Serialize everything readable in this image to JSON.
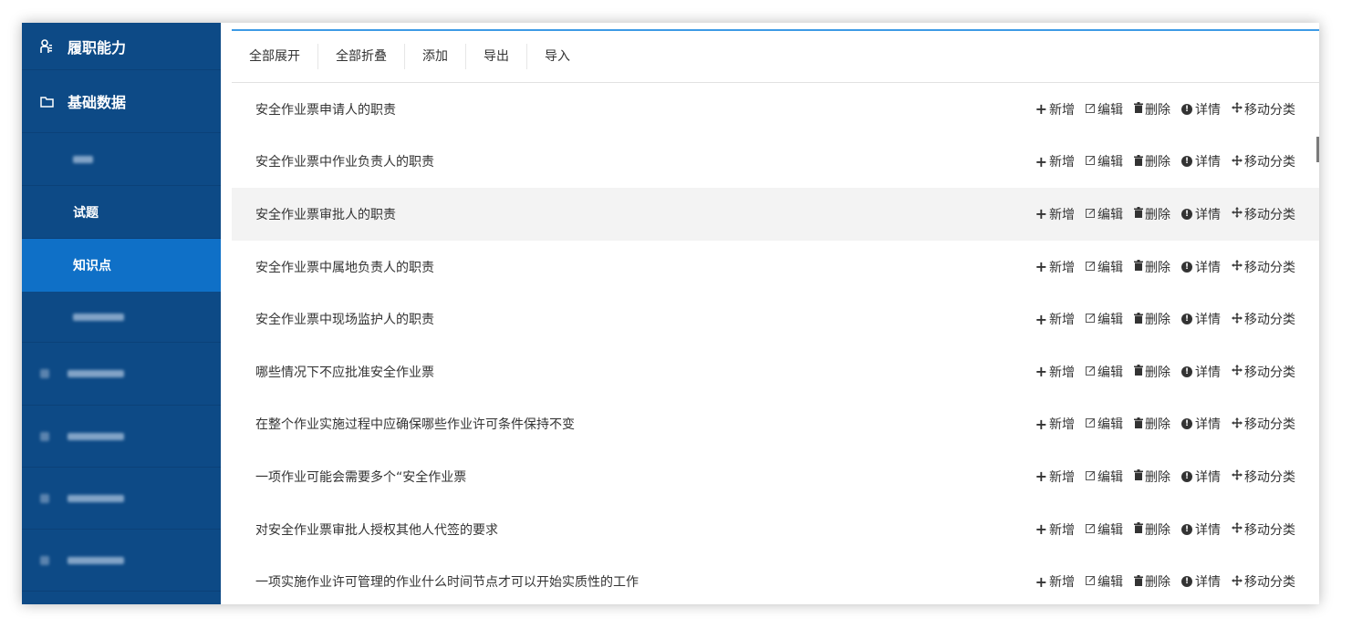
{
  "sidebar": {
    "sections": [
      {
        "label": "履职能力",
        "icon": "user-badge-icon"
      },
      {
        "label": "基础数据",
        "icon": "folder-icon"
      }
    ],
    "subitems": [
      {
        "label": "",
        "blurred": true
      },
      {
        "label": "试题",
        "blurred": false
      },
      {
        "label": "知识点",
        "blurred": false,
        "active": true
      },
      {
        "label": "",
        "blurred": true
      }
    ],
    "more_sections": [
      {
        "label": "",
        "blurred": true
      },
      {
        "label": "",
        "blurred": true
      },
      {
        "label": "",
        "blurred": true
      },
      {
        "label": "",
        "blurred": true
      }
    ]
  },
  "toolbar": {
    "expand_all": "全部展开",
    "collapse_all": "全部折叠",
    "add": "添加",
    "export": "导出",
    "import": "导入"
  },
  "actions": {
    "add": "新增",
    "edit": "编辑",
    "delete": "删除",
    "detail": "详情",
    "move": "移动分类"
  },
  "rows": [
    {
      "title": "安全作业票申请人的职责"
    },
    {
      "title": "安全作业票中作业负责人的职责"
    },
    {
      "title": "安全作业票审批人的职责"
    },
    {
      "title": "安全作业票中属地负责人的职责"
    },
    {
      "title": "安全作业票中现场监护人的职责"
    },
    {
      "title": "哪些情况下不应批准安全作业票"
    },
    {
      "title": "在整个作业实施过程中应确保哪些作业许可条件保持不变"
    },
    {
      "title": "一项作业可能会需要多个“安全作业票"
    },
    {
      "title": "对安全作业票审批人授权其他人代签的要求"
    },
    {
      "title": "一项实施作业许可管理的作业什么时间节点才可以开始实质性的工作"
    }
  ],
  "colors": {
    "sidebar_bg": "#0d4a86",
    "active_bg": "#0f70c7",
    "accent_line": "#3d9ae5",
    "highlight_row": "#f3f3f3"
  }
}
